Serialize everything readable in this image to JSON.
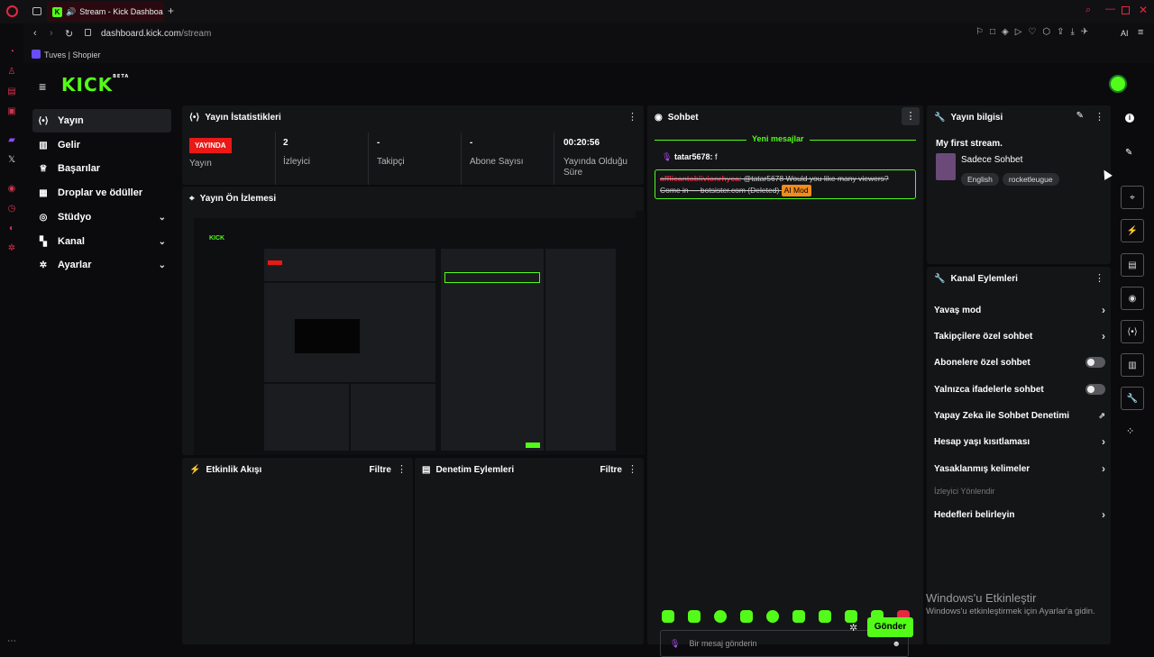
{
  "browser": {
    "tab_title": "Stream - Kick Dashboa",
    "url_host": "dashboard.kick.com",
    "url_path": "/stream",
    "bookmark": "Tuves | Shopier",
    "ai_label": "AI"
  },
  "header": {
    "logo": "KICK",
    "logo_beta": "BETA"
  },
  "sidebar": {
    "items": [
      {
        "label": "Yayın",
        "icon": "broadcast-icon"
      },
      {
        "label": "Gelir",
        "icon": "revenue-icon"
      },
      {
        "label": "Başarılar",
        "icon": "trophy-icon"
      },
      {
        "label": "Droplar ve ödüller",
        "icon": "gift-icon"
      },
      {
        "label": "Stüdyo",
        "icon": "studio-icon"
      },
      {
        "label": "Kanal",
        "icon": "channel-icon"
      },
      {
        "label": "Ayarlar",
        "icon": "gear-icon"
      }
    ]
  },
  "stats": {
    "title": "Yayın İstatistikleri",
    "live_badge": "YAYINDA",
    "live_label": "Yayın",
    "viewers_value": "2",
    "viewers_label": "İzleyici",
    "followers_value": "-",
    "followers_label": "Takipçi",
    "subs_value": "-",
    "subs_label": "Abone Sayısı",
    "time_value": "00:20:56",
    "time_label": "Yayında Olduğu Süre"
  },
  "preview": {
    "title": "Yayın Ön İzlemesi"
  },
  "events": {
    "title": "Etkinlik Akışı",
    "filter": "Filtre"
  },
  "moderation": {
    "title": "Denetim Eylemleri",
    "filter": "Filtre"
  },
  "chat": {
    "title": "Sohbet",
    "new_messages": "Yeni mesajlar",
    "msg1_user": "tatar5678:",
    "msg1_text": " f",
    "msg2_user": "afflicantoblivionrhyca",
    "msg2_text": ": @tatar5678 Would you like many viewers? Come in — botsister.com (Deleted)",
    "msg2_badge": "AI Mod",
    "input_placeholder": "Bir mesaj gönderin",
    "send": "Gönder"
  },
  "info": {
    "title": "Yayın bilgisi",
    "stream_title": "My first stream.",
    "category": "Sadece Sohbet",
    "tags": [
      "English",
      "rocketleugue"
    ]
  },
  "actions": {
    "title": "Kanal Eylemleri",
    "slow": "Yavaş mod",
    "followers": "Takipçilere özel sohbet",
    "subs": "Abonelere özel sohbet",
    "emotes": "Yalnızca ifadelerle sohbet",
    "ai": "Yapay Zeka ile Sohbet Denetimi",
    "age": "Hesap yaşı kısıtlaması",
    "banned": "Yasaklanmış kelimeler",
    "section": "İzleyici Yönlendir",
    "goals": "Hedefleri belirleyin"
  },
  "windows": {
    "line1": "Windows'u Etkinleştir",
    "line2": "Windows'u etkinleştirmek için Ayarlar'a gidin."
  },
  "colors": {
    "accent": "#53fc18",
    "live": "#e91916",
    "panel": "#141517"
  }
}
